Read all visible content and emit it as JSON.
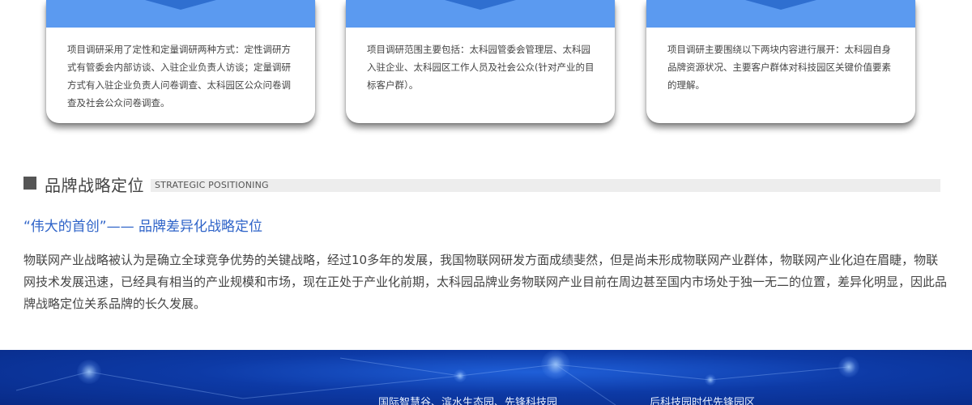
{
  "cards": [
    {
      "text": "项目调研采用了定性和定量调研两种方式：定性调研方式有管委会内部访谈、入驻企业负责人访谈；定量调研方式有入驻企业负责人问卷调查、太科园区公众问卷调查及社会公众问卷调查。"
    },
    {
      "text": "项目调研范围主要包括：太科园管委会管理层、太科园入驻企业、太科园区工作人员及社会公众(针对产业的目标客户群）。"
    },
    {
      "text": "项目调研主要围绕以下两块内容进行展开：太科园自身品牌资源状况、主要客户群体对科技园区关键价值要素的理解。"
    }
  ],
  "section": {
    "title": "品牌战略定位",
    "title_en": "STRATEGIC POSITIONING"
  },
  "subheading": "“伟大的首创”—— 品牌差异化战略定位",
  "paragraph": "物联网产业战略被认为是确立全球竞争优势的关键战略，经过10多年的发展，我国物联网研发方面成绩斐然，但是尚未形成物联网产业群体，物联网产业化迫在眉睫，物联网技术发展迅速，已经具有相当的产业规模和市场，现在正处于产业化前期，太科园品牌业务物联网产业目前在周边甚至国内市场处于独一无二的位置，差异化明显，因此品牌战略定位关系品牌的长久发展。",
  "footer": {
    "text1": "国际智慧谷、滨水生态园、先锋科技园",
    "text2": "后科技园时代先锋园区"
  },
  "colors": {
    "accent_blue": "#2e63c8",
    "card_header": "#5b9af0",
    "footer_bg": "#0d3aa6"
  }
}
